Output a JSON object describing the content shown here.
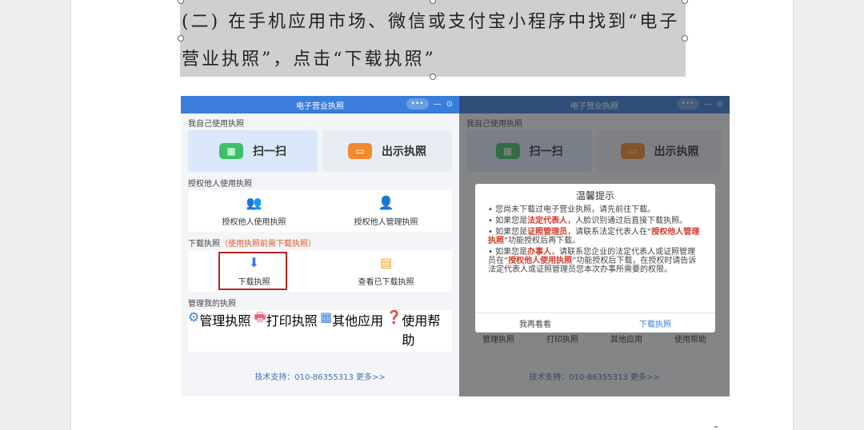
{
  "document": {
    "selected_text_line1": "(二) 在手机应用市场、微信或支付宝小程序中找到“电子",
    "selected_text_line2": "营业执照”，点击“下载执照”"
  },
  "app": {
    "title": "电子营业执照",
    "capsule": "•••",
    "minimize": "—",
    "close": "⊙",
    "section_self": "我自己使用执照",
    "scan_label": "扫一扫",
    "show_label": "出示执照",
    "section_authorize": "授权他人使用执照",
    "authorize_use": "授权他人使用执照",
    "authorize_manage": "授权他人管理执照",
    "section_download": "下载执照",
    "download_note": "（使用执照前需下载执照）",
    "download_label": "下载执照",
    "view_downloaded": "查看已下载执照",
    "section_manage": "管理我的执照",
    "manage_items": [
      "管理执照",
      "打印执照",
      "其他应用",
      "使用帮助"
    ],
    "support": "技术支持：010-86355313  更多>>"
  },
  "dialog": {
    "title": "温馨提示",
    "line1": "• 您尚未下载过电子营业执照，请先前往下载。",
    "line2_pre": "• 如果您是",
    "line2_hl": "法定代表人",
    "line2_post": "，人脸识别通过后直接下载执照。",
    "line3_pre": "• 如果您是",
    "line3_hl": "证照管理员",
    "line3_mid": "，请联系法定代表人在“",
    "line3_hl2": "授权他人管理执照",
    "line3_post": "”功能授权后再下载。",
    "line4_pre": "• 如果您是",
    "line4_hl": "办事人",
    "line4_mid": "，请联系您企业的法定代表人或证照管理员在“",
    "line4_hl2": "授权他人使用执照",
    "line4_post": "”功能授权后下载，在授权时请告诉法定代表人或证照管理员您本次办事所需要的权限。",
    "later": "我再看看",
    "download": "下载执照"
  }
}
